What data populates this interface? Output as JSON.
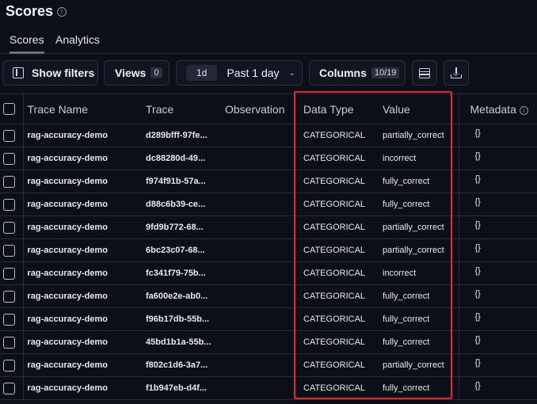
{
  "page": {
    "title": "Scores"
  },
  "tabs": [
    {
      "label": "Scores",
      "active": true
    },
    {
      "label": "Analytics",
      "active": false
    }
  ],
  "toolbar": {
    "filters_label": "Show filters",
    "views_label": "Views",
    "views_count": "0",
    "range_chip": "1d",
    "range_label": "Past 1 day",
    "columns_label": "Columns",
    "columns_count": "10/19"
  },
  "table": {
    "headers": {
      "name": "Trace Name",
      "trace": "Trace",
      "observation": "Observation",
      "data_type": "Data Type",
      "value": "Value",
      "metadata": "Metadata"
    },
    "rows": [
      {
        "name": "rag-accuracy-demo",
        "trace": "d289bfff-97fe...",
        "observation": "",
        "data_type": "CATEGORICAL",
        "value": "partially_correct",
        "metadata": "{}"
      },
      {
        "name": "rag-accuracy-demo",
        "trace": "dc88280d-49...",
        "observation": "",
        "data_type": "CATEGORICAL",
        "value": "incorrect",
        "metadata": "{}"
      },
      {
        "name": "rag-accuracy-demo",
        "trace": "f974f91b-57a...",
        "observation": "",
        "data_type": "CATEGORICAL",
        "value": "fully_correct",
        "metadata": "{}"
      },
      {
        "name": "rag-accuracy-demo",
        "trace": "d88c6b39-ce...",
        "observation": "",
        "data_type": "CATEGORICAL",
        "value": "fully_correct",
        "metadata": "{}"
      },
      {
        "name": "rag-accuracy-demo",
        "trace": "9fd9b772-68...",
        "observation": "",
        "data_type": "CATEGORICAL",
        "value": "partially_correct",
        "metadata": "{}"
      },
      {
        "name": "rag-accuracy-demo",
        "trace": "6bc23c07-68...",
        "observation": "",
        "data_type": "CATEGORICAL",
        "value": "partially_correct",
        "metadata": "{}"
      },
      {
        "name": "rag-accuracy-demo",
        "trace": "fc341f79-75b...",
        "observation": "",
        "data_type": "CATEGORICAL",
        "value": "incorrect",
        "metadata": "{}"
      },
      {
        "name": "rag-accuracy-demo",
        "trace": "fa600e2e-ab0...",
        "observation": "",
        "data_type": "CATEGORICAL",
        "value": "fully_correct",
        "metadata": "{}"
      },
      {
        "name": "rag-accuracy-demo",
        "trace": "f96b17db-55b...",
        "observation": "",
        "data_type": "CATEGORICAL",
        "value": "fully_correct",
        "metadata": "{}"
      },
      {
        "name": "rag-accuracy-demo",
        "trace": "45bd1b1a-55b...",
        "observation": "",
        "data_type": "CATEGORICAL",
        "value": "fully_correct",
        "metadata": "{}"
      },
      {
        "name": "rag-accuracy-demo",
        "trace": "f802c1d6-3a7...",
        "observation": "",
        "data_type": "CATEGORICAL",
        "value": "partially_correct",
        "metadata": "{}"
      },
      {
        "name": "rag-accuracy-demo",
        "trace": "f1b947eb-d4f...",
        "observation": "",
        "data_type": "CATEGORICAL",
        "value": "fully_correct",
        "metadata": "{}"
      }
    ]
  },
  "icons": {
    "title_info": "info-icon",
    "filters": "sidebar-panel-icon",
    "range": "chevron-down-icon",
    "row_height": "rows-icon",
    "download": "download-icon"
  },
  "colors": {
    "background": "#0b0f17",
    "highlight": "#e8262a"
  }
}
